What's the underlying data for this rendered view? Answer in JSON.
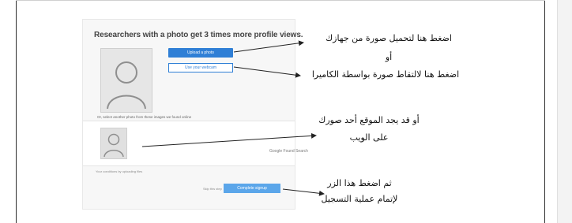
{
  "signup_card": {
    "headline": "Researchers with a photo get 3 times more profile views.",
    "upload_button": "Upload a photo",
    "webcam_button": "Use your webcam",
    "or_select": "Or, select another photo from these images we found online",
    "google_label": "Google Found Search",
    "terms": "Your conditions by uploading files",
    "skip_link": "Skip this step",
    "signup_button": "Complete signup"
  },
  "annotations": {
    "upload_note": "اضغط هنا لتحميل صورة من جهازك",
    "or_word": "أو",
    "webcam_note": "اضغط هنا لالتقاط صورة بواسطة الكاميرا",
    "web_note_line1": "أو قد يجد الموقع أحد صورك",
    "web_note_line2": "على الويب",
    "signup_note_line1": "ثم اضغط هذا الزر",
    "signup_note_line2": "لإتمام عملية التسجيل"
  },
  "colors": {
    "primary_blue": "#2f7fd6",
    "signup_blue": "#5ba6ea",
    "card_bg": "#f7f7f7"
  }
}
